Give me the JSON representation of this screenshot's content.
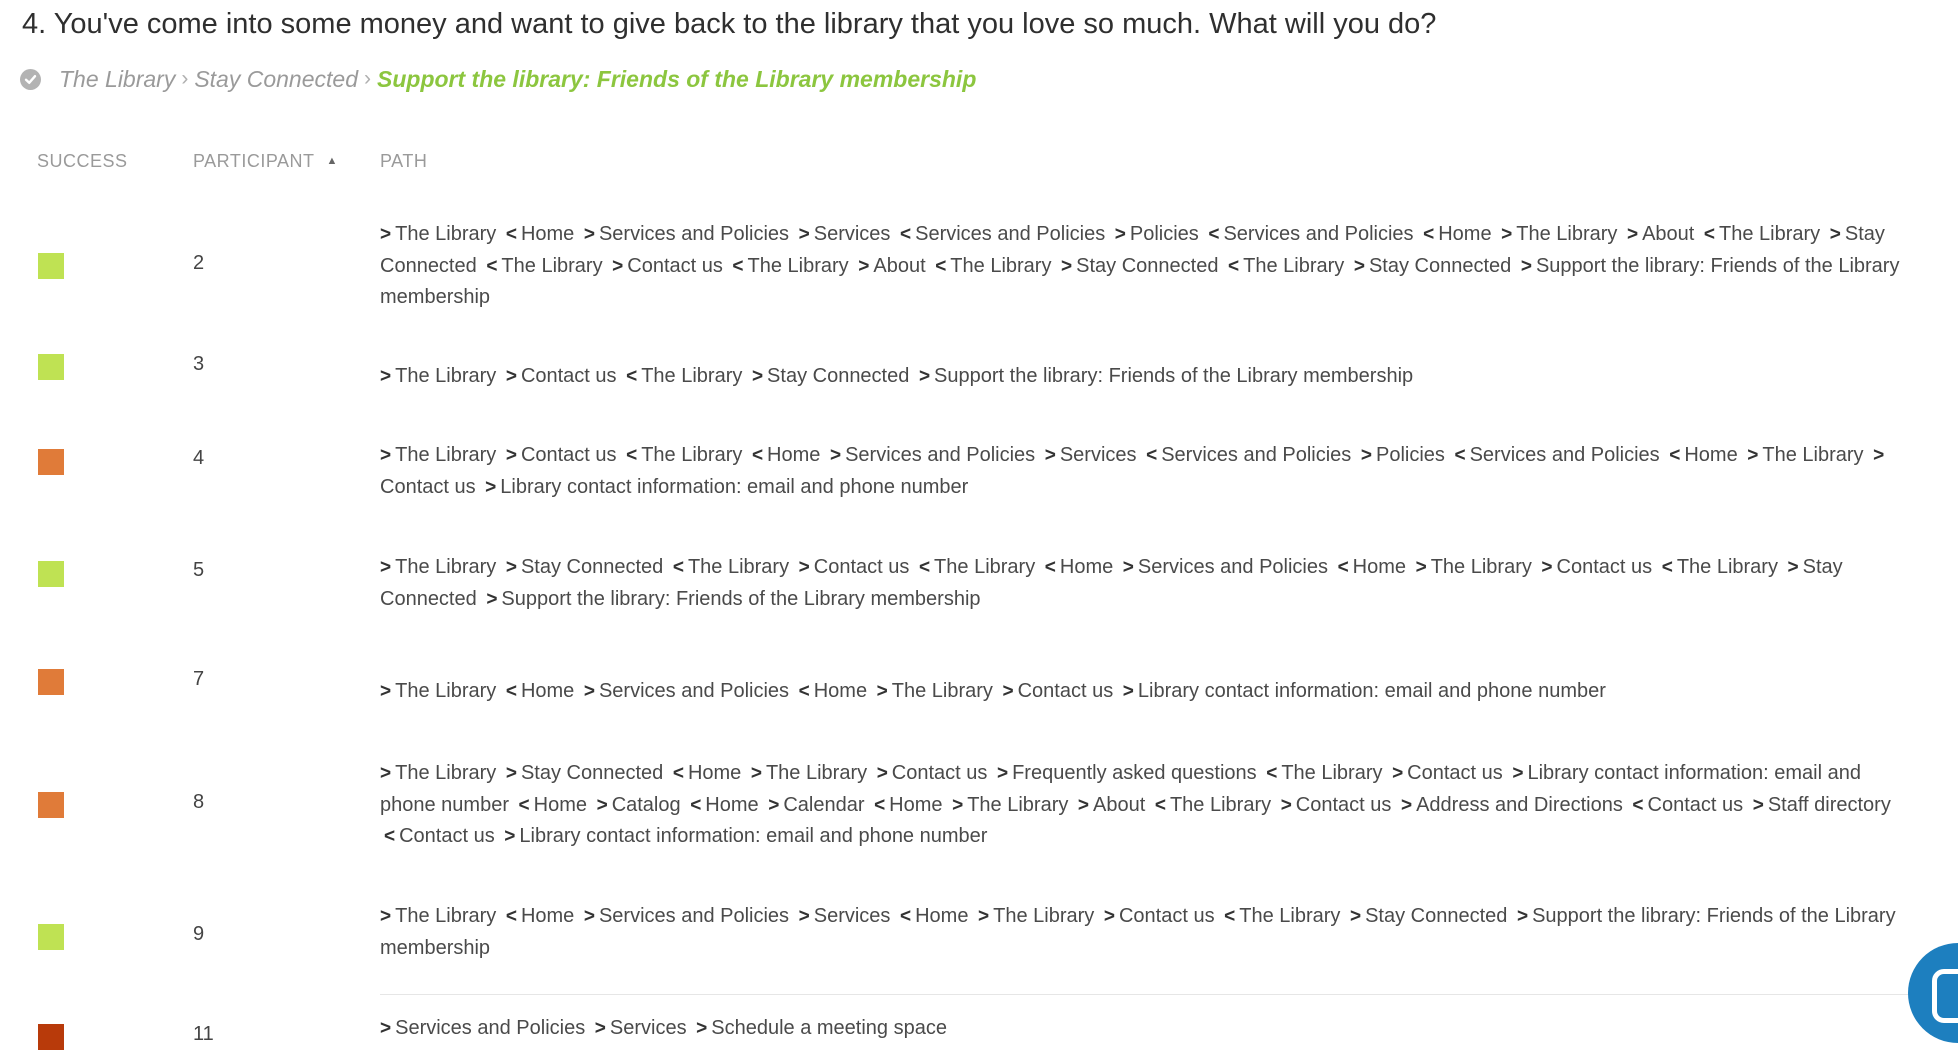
{
  "question": {
    "text": "4. You've come into some money and want to give back to the library that you love so much. What will you do?"
  },
  "breadcrumb": {
    "items": [
      "The Library",
      "Stay Connected"
    ],
    "target": "Support the library: Friends of the Library membership"
  },
  "columns": {
    "success": "SUCCESS",
    "participant": "PARTICIPANT",
    "path": "PATH"
  },
  "colors": {
    "success": "#bfe253",
    "indirect_fail": "#e07b39",
    "direct_fail": "#b83a0a",
    "target_green": "#8cc63f"
  },
  "rows": [
    {
      "participant": "2",
      "outcome": "success",
      "steps": [
        [
          ">",
          "The Library"
        ],
        [
          "<",
          "Home"
        ],
        [
          ">",
          "Services and Policies"
        ],
        [
          ">",
          "Services"
        ],
        [
          "<",
          "Services and Policies"
        ],
        [
          ">",
          "Policies"
        ],
        [
          "<",
          "Services and Policies"
        ],
        [
          "<",
          "Home"
        ],
        [
          ">",
          "The Library"
        ],
        [
          ">",
          "About"
        ],
        [
          "<",
          "The Library"
        ],
        [
          ">",
          "Stay Connected"
        ],
        [
          "<",
          "The Library"
        ],
        [
          ">",
          "Contact us"
        ],
        [
          "<",
          "The Library"
        ],
        [
          ">",
          "About"
        ],
        [
          "<",
          "The Library"
        ],
        [
          ">",
          "Stay Connected"
        ],
        [
          "<",
          "The Library"
        ],
        [
          ">",
          "Stay Connected"
        ],
        [
          ">",
          "Support the library: Friends of the Library membership"
        ]
      ]
    },
    {
      "participant": "3",
      "outcome": "success",
      "steps": [
        [
          ">",
          "The Library"
        ],
        [
          ">",
          "Contact us"
        ],
        [
          "<",
          "The Library"
        ],
        [
          ">",
          "Stay Connected"
        ],
        [
          ">",
          "Support the library: Friends of the Library membership"
        ]
      ]
    },
    {
      "participant": "4",
      "outcome": "indirect_fail",
      "steps": [
        [
          ">",
          "The Library"
        ],
        [
          ">",
          "Contact us"
        ],
        [
          "<",
          "The Library"
        ],
        [
          "<",
          "Home"
        ],
        [
          ">",
          "Services and Policies"
        ],
        [
          ">",
          "Services"
        ],
        [
          "<",
          "Services and Policies"
        ],
        [
          ">",
          "Policies"
        ],
        [
          "<",
          "Services and Policies"
        ],
        [
          "<",
          "Home"
        ],
        [
          ">",
          "The Library"
        ],
        [
          ">",
          "Contact us"
        ],
        [
          ">",
          "Library contact information: email and phone number"
        ]
      ]
    },
    {
      "participant": "5",
      "outcome": "success",
      "steps": [
        [
          ">",
          "The Library"
        ],
        [
          ">",
          "Stay Connected"
        ],
        [
          "<",
          "The Library"
        ],
        [
          ">",
          "Contact us"
        ],
        [
          "<",
          "The Library"
        ],
        [
          "<",
          "Home"
        ],
        [
          ">",
          "Services and Policies"
        ],
        [
          "<",
          "Home"
        ],
        [
          ">",
          "The Library"
        ],
        [
          ">",
          "Contact us"
        ],
        [
          "<",
          "The Library"
        ],
        [
          ">",
          "Stay Connected"
        ],
        [
          ">",
          "Support the library: Friends of the Library membership"
        ]
      ]
    },
    {
      "participant": "7",
      "outcome": "indirect_fail",
      "steps": [
        [
          ">",
          "The Library"
        ],
        [
          "<",
          "Home"
        ],
        [
          ">",
          "Services and Policies"
        ],
        [
          "<",
          "Home"
        ],
        [
          ">",
          "The Library"
        ],
        [
          ">",
          "Contact us"
        ],
        [
          ">",
          "Library contact information: email and phone number"
        ]
      ]
    },
    {
      "participant": "8",
      "outcome": "indirect_fail",
      "steps": [
        [
          ">",
          "The Library"
        ],
        [
          ">",
          "Stay Connected"
        ],
        [
          "<",
          "Home"
        ],
        [
          ">",
          "The Library"
        ],
        [
          ">",
          "Contact us"
        ],
        [
          ">",
          "Frequently asked questions"
        ],
        [
          "<",
          "The Library"
        ],
        [
          ">",
          "Contact us"
        ],
        [
          ">",
          "Library contact information: email and phone number"
        ],
        [
          "<",
          "Home"
        ],
        [
          ">",
          "Catalog"
        ],
        [
          "<",
          "Home"
        ],
        [
          ">",
          "Calendar"
        ],
        [
          "<",
          "Home"
        ],
        [
          ">",
          "The Library"
        ],
        [
          ">",
          "About"
        ],
        [
          "<",
          "The Library"
        ],
        [
          ">",
          "Contact us"
        ],
        [
          ">",
          "Address and Directions"
        ],
        [
          "<",
          "Contact us"
        ],
        [
          ">",
          "Staff directory"
        ],
        [
          "<",
          "Contact us"
        ],
        [
          ">",
          "Library contact information: email and phone number"
        ]
      ]
    },
    {
      "participant": "9",
      "outcome": "success",
      "steps": [
        [
          ">",
          "The Library"
        ],
        [
          "<",
          "Home"
        ],
        [
          ">",
          "Services and Policies"
        ],
        [
          ">",
          "Services"
        ],
        [
          "<",
          "Home"
        ],
        [
          ">",
          "The Library"
        ],
        [
          ">",
          "Contact us"
        ],
        [
          "<",
          "The Library"
        ],
        [
          ">",
          "Stay Connected"
        ],
        [
          ">",
          "Support the library: Friends of the Library membership"
        ]
      ]
    },
    {
      "participant": "11",
      "outcome": "direct_fail",
      "steps": [
        [
          ">",
          "Services and Policies"
        ],
        [
          ">",
          "Services"
        ],
        [
          ">",
          "Schedule a meeting space"
        ]
      ]
    }
  ]
}
